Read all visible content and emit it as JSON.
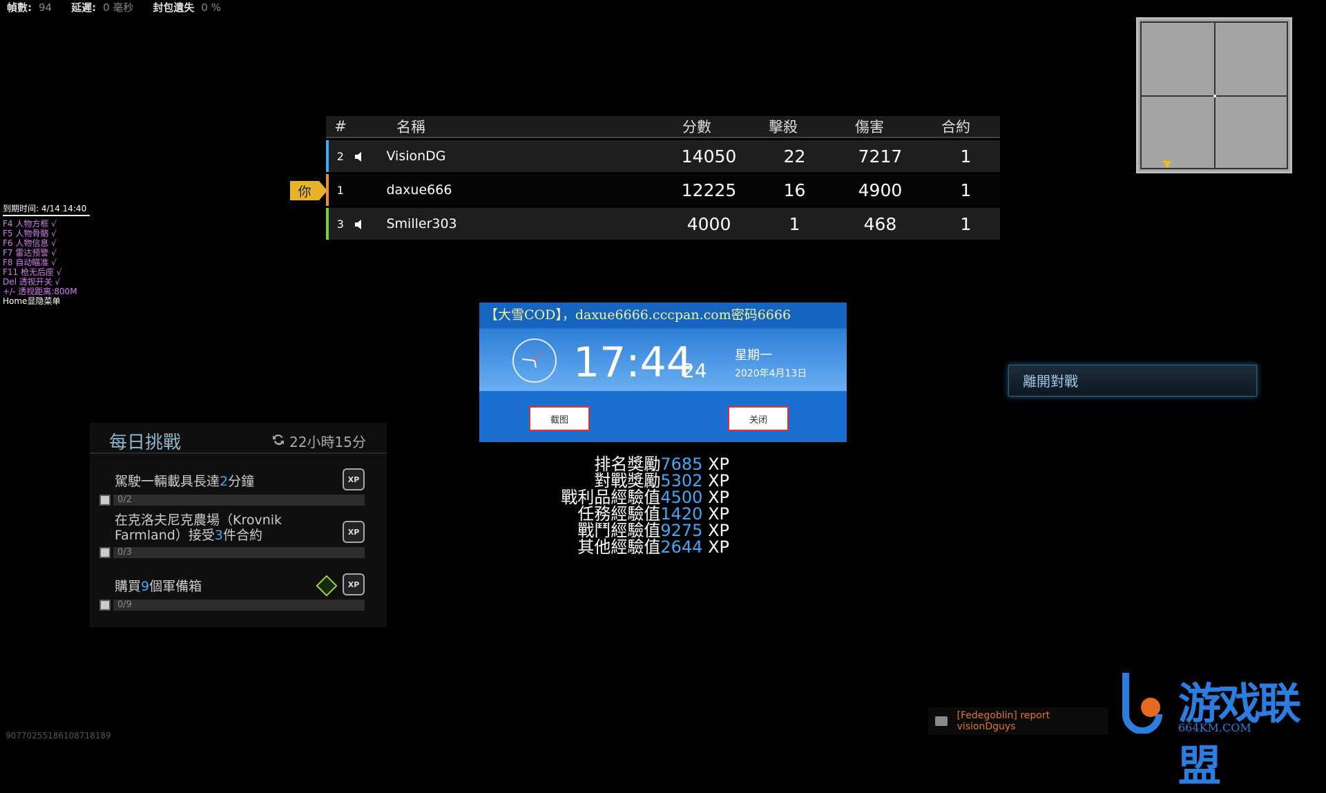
{
  "stats": [
    {
      "label": "幀數:",
      "value": "94"
    },
    {
      "label": "延遲:",
      "value": "0 毫秒"
    },
    {
      "label": "封包遺失",
      "value": "0 %"
    }
  ],
  "scoreboard": {
    "headers": {
      "rank": "#",
      "name": "名稱",
      "score": "分數",
      "kills": "擊殺",
      "damage": "傷害",
      "contracts": "合約"
    },
    "rows": [
      {
        "rank": "2",
        "name": "VisionDG",
        "score": "14050",
        "kills": "22",
        "damage": "7217",
        "contracts": "1",
        "bar_color": "#3fa9f5",
        "speaker": true
      },
      {
        "rank": "1",
        "name": "daxue666",
        "score": "12225",
        "kills": "16",
        "damage": "4900",
        "contracts": "1",
        "bar_color": "#e6953a",
        "speaker": false
      },
      {
        "rank": "3",
        "name": "Smiller303",
        "score": "4000",
        "kills": "1",
        "damage": "468",
        "contracts": "1",
        "bar_color": "#7dd03a",
        "speaker": true
      }
    ],
    "you_label": "你"
  },
  "cheat_menu": {
    "expiry": "到期时间: 4/14 14:40",
    "lines": [
      "F4  人物方框  √",
      "F5  人物骨骼  √",
      "F6  人物信息  √",
      "F7  雷达预警  √",
      "F8  自动瞄准  √",
      "F11 枪无后座  √",
      "Del 透视开关  √",
      "+/- 透视距离:800M"
    ],
    "footer": "Home显隐菜单"
  },
  "daily": {
    "title": "每日挑戰",
    "timer": "22小時15分",
    "tasks": [
      {
        "text_pre": "駕駛一輛載具長達",
        "hl": "2",
        "text_post": "分鐘",
        "progress": "0/2"
      },
      {
        "text_pre": "在克洛夫尼克農場（Krovnik Farmland）接受",
        "hl": "3",
        "text_post": "件合約",
        "progress": "0/3"
      },
      {
        "text_pre": "購買",
        "hl": "9",
        "text_post": "個軍備箱",
        "progress": "0/9"
      }
    ],
    "xp_badge": "XP"
  },
  "xp_rewards": [
    {
      "label": "排名獎勵",
      "value": "7685",
      "unit": "XP"
    },
    {
      "label": "對戰獎勵",
      "value": "5302",
      "unit": "XP"
    },
    {
      "label": "戰利品經驗值",
      "value": "4500",
      "unit": "XP"
    },
    {
      "label": "任務經驗值",
      "value": "1420",
      "unit": "XP"
    },
    {
      "label": "戰鬥經驗值",
      "value": "9275",
      "unit": "XP"
    },
    {
      "label": "其他經驗值",
      "value": "2644",
      "unit": "XP"
    }
  ],
  "popup": {
    "title": "【大雪COD】，daxue6666.cccpan.com密码6666",
    "time": "17:44",
    "seconds": "24",
    "weekday": "星期一",
    "date": "2020年4月13日",
    "btn_screenshot": "截图",
    "btn_close": "关闭"
  },
  "leave_button": "離開對戰",
  "chat": {
    "message": "[Fedegoblin] report visionDguys"
  },
  "watermark": {
    "logo": "游戏联盟",
    "url": "664KM.COM"
  },
  "serial": "90770255186108718189"
}
